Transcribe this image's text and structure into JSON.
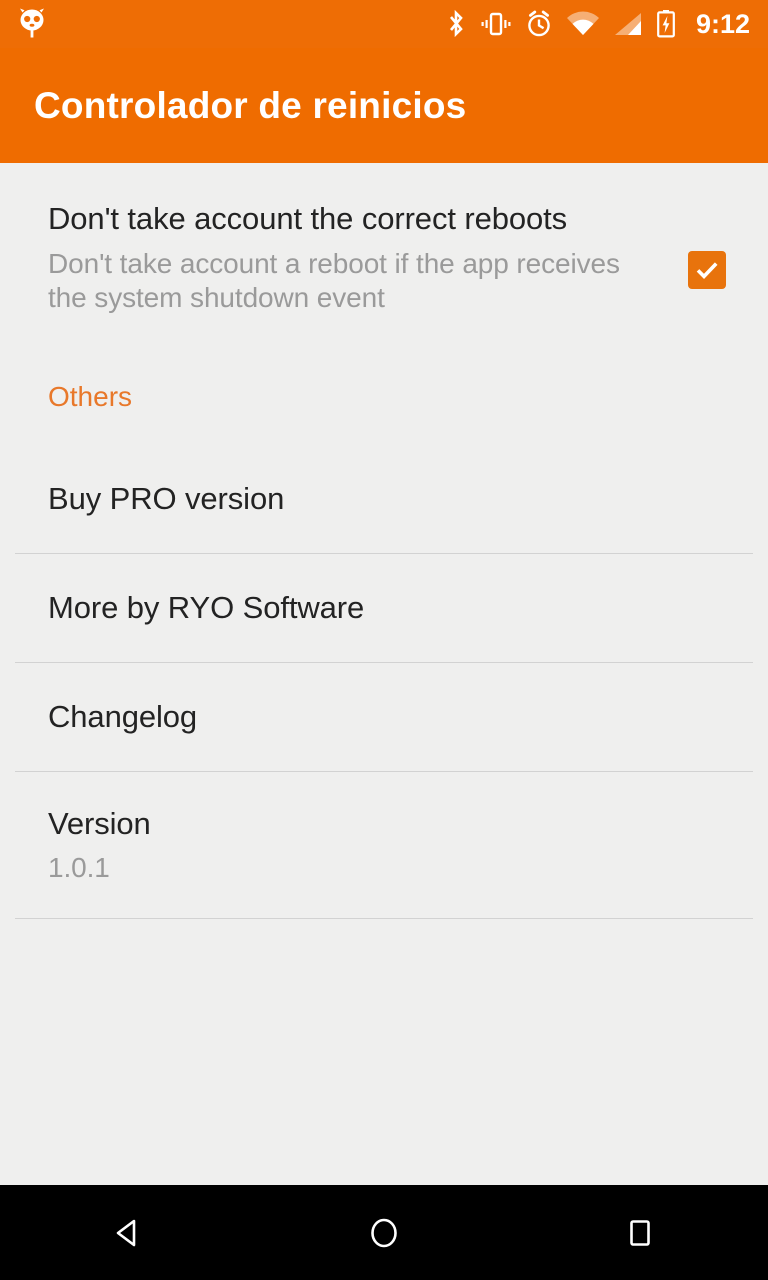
{
  "colors": {
    "status_bar": "#ee6d05",
    "app_bar": "#ef6c00",
    "content_bg": "#efefee",
    "accent": "#e8782a",
    "checkbox_fill": "#e8730c",
    "title_text": "#232323",
    "summary_text": "#9a9a9a",
    "divider": "#d2d2d2",
    "nav_bar": "#000000"
  },
  "status_bar": {
    "launcher_icon": "cyanogenmod-head-icon",
    "icons": [
      "bluetooth-icon",
      "vibrate-icon",
      "alarm-icon",
      "wifi-icon",
      "cellular-signal-icon",
      "battery-charging-icon"
    ],
    "clock": "9:12"
  },
  "app_bar": {
    "title": "Controlador de reinicios"
  },
  "preferences": {
    "checkbox_pref": {
      "title": "Don't take account the correct reboots",
      "summary": "Don't take account a reboot if the app receives the system shutdown event",
      "checked": true,
      "checkbox_icon": "checkmark-icon"
    },
    "section_header": "Others",
    "items": [
      {
        "title": "Buy PRO version",
        "summary": ""
      },
      {
        "title": "More by RYO Software",
        "summary": ""
      },
      {
        "title": "Changelog",
        "summary": ""
      },
      {
        "title": "Version",
        "summary": "1.0.1"
      }
    ]
  },
  "nav_bar": {
    "back_label": "back-icon",
    "home_label": "home-icon",
    "recents_label": "recents-icon"
  }
}
